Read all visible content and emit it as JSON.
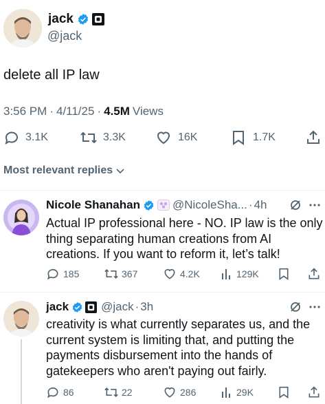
{
  "main_tweet": {
    "name": "jack",
    "handle": "@jack",
    "text": "delete all IP law",
    "time": "3:56 PM",
    "sep": "·",
    "date": "4/11/25",
    "views_count": "4.5M",
    "views_label": "Views",
    "actions": {
      "replies": "3.1K",
      "retweets": "3.3K",
      "likes": "16K",
      "bookmarks": "1.7K"
    }
  },
  "replies_sort": {
    "label": "Most relevant replies"
  },
  "replies": [
    {
      "name": "Nicole Shanahan",
      "handle": "@NicoleSha...",
      "sep": "·",
      "age": "4h",
      "text": "Actual IP professional here - NO. IP law is the only thing separating human creations from AI creations. If you want to reform it, let’s talk!",
      "replies": "185",
      "retweets": "367",
      "likes": "4.2K",
      "views": "129K"
    },
    {
      "name": "jack",
      "handle": "@jack",
      "sep": "·",
      "age": "3h",
      "text": "creativity is what currently separates us, and the current system is limiting that, and putting the payments disbursement into the hands of gatekeepers who aren't paying out fairly.",
      "replies": "86",
      "retweets": "22",
      "likes": "286",
      "views": "29K"
    }
  ],
  "colors": {
    "text": "#0f1419",
    "muted": "#536471",
    "verified": "#1d9bf0",
    "divider": "#eff3f4"
  },
  "icons": [
    "verified-badge-icon",
    "square-badge-icon",
    "reply-icon",
    "retweet-icon",
    "like-icon",
    "bookmark-icon",
    "share-icon",
    "chevron-down-icon",
    "grok-icon",
    "more-icon",
    "views-icon",
    "affiliation-badge-icon"
  ]
}
